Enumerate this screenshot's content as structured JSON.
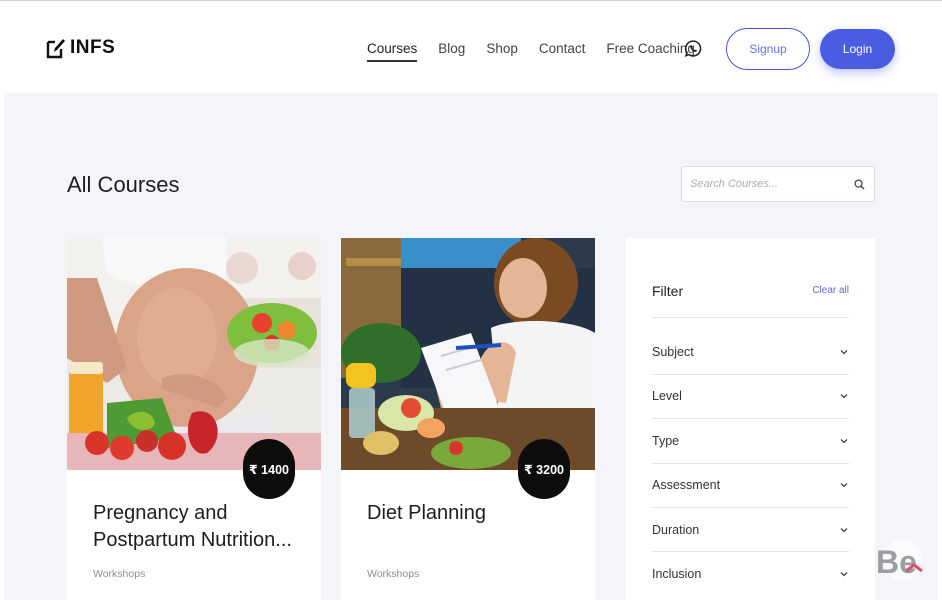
{
  "header": {
    "logo_text": "INFS",
    "nav": [
      {
        "label": "Courses",
        "active": true
      },
      {
        "label": "Blog"
      },
      {
        "label": "Shop"
      },
      {
        "label": "Contact"
      },
      {
        "label": "Free Coaching"
      }
    ],
    "signup_label": "Signup",
    "login_label": "Login"
  },
  "main": {
    "title": "All Courses",
    "search_placeholder": "Search Courses..."
  },
  "courses": [
    {
      "title": "Pregnancy and Postpartum Nutrition...",
      "price": "₹ 1400",
      "tag": "Workshops"
    },
    {
      "title": "Diet Planning",
      "price": "₹ 3200",
      "tag": "Workshops"
    }
  ],
  "filter": {
    "title": "Filter",
    "clear_label": "Clear all",
    "items": [
      {
        "label": "Subject"
      },
      {
        "label": "Level"
      },
      {
        "label": "Type"
      },
      {
        "label": "Assessment"
      },
      {
        "label": "Duration"
      },
      {
        "label": "Inclusion"
      }
    ]
  },
  "colors": {
    "accent": "#4a5ce2",
    "page_background": "#f4f5f9",
    "price_badge": "#0d0d0d"
  },
  "watermark_text": "Be"
}
